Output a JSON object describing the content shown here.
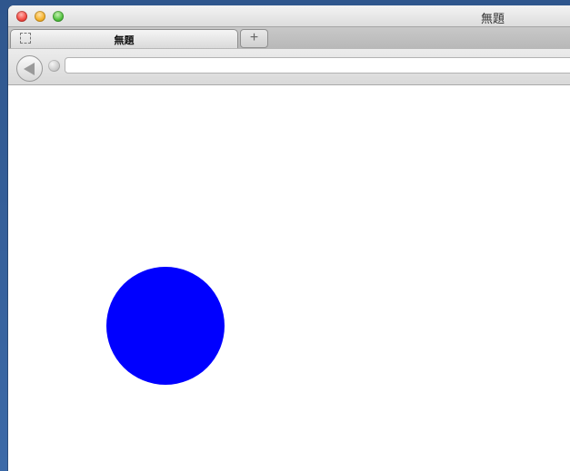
{
  "window": {
    "title": "無題"
  },
  "tabs": [
    {
      "label": "無題",
      "active": true
    }
  ],
  "toolbar": {
    "new_tab_label": "+",
    "address": {
      "value": "",
      "placeholder": ""
    },
    "back_icon": "back-icon",
    "site_icon": "globe-icon"
  },
  "content": {
    "shape": "circle",
    "fill": "#0000ff"
  }
}
